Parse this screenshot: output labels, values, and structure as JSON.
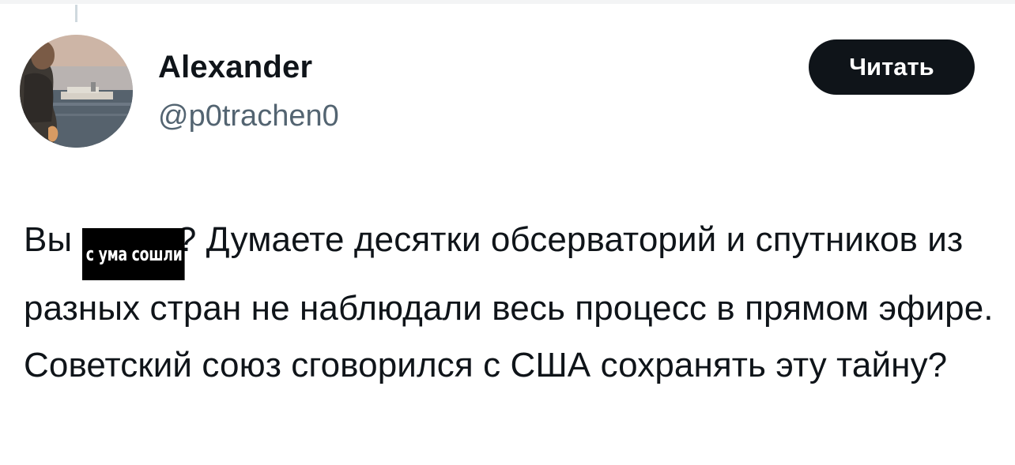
{
  "user": {
    "display_name": "Alexander",
    "handle": "@p0trachen0"
  },
  "follow_button": {
    "label": "Читать"
  },
  "tweet": {
    "text_start": "Вы ",
    "censored_text": "с ума сошли",
    "text_rest": "? Думаете десятки обсерваторий и спутников из разных стран не наблюдали весь процесс в прямом эфире. Советский союз сговорился с США сохранять эту тайну?"
  },
  "colors": {
    "text_primary": "#0f1419",
    "text_secondary": "#536471",
    "button_bg": "#0f1419",
    "button_text": "#ffffff",
    "censor_bg": "#000000"
  }
}
